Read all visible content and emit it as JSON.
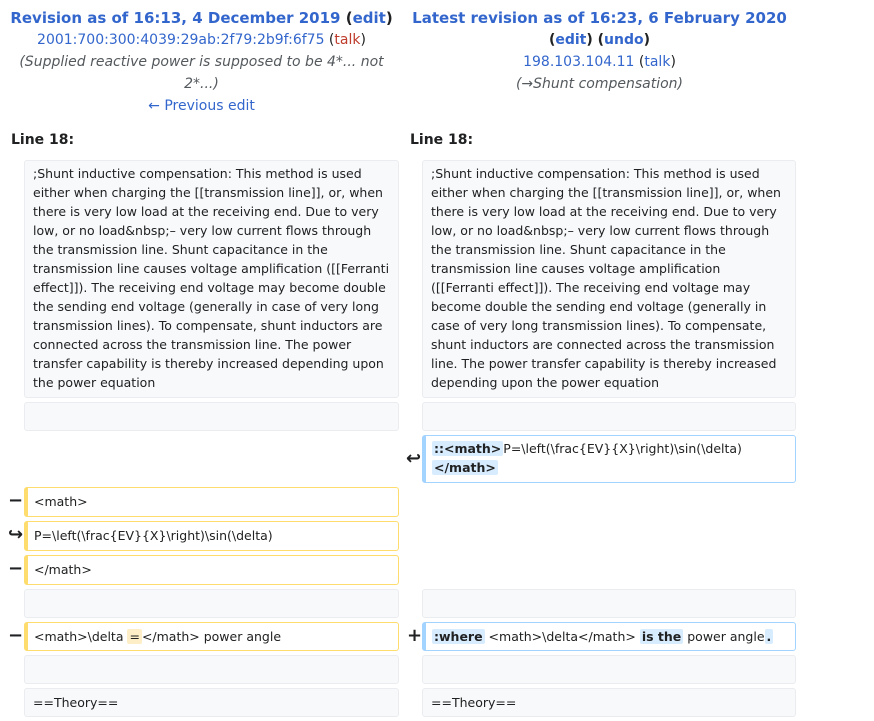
{
  "left_header": {
    "title": "Revision as of 16:13, 4 December 2019",
    "edit_label": "edit",
    "user": "2001:700:300:4039:29ab:2f79:2b9f:6f75",
    "talk_label": "talk",
    "summary": "(Supplied reactive power is supposed to be 4*... not 2*...)",
    "prev_edit": "← Previous edit"
  },
  "right_header": {
    "title": "Latest revision as of 16:23, 6 February 2020",
    "edit_label": "edit",
    "undo_label": "undo",
    "user": "198.103.104.11",
    "talk_label": "talk",
    "summary": "(→Shunt compensation)"
  },
  "line_label": "Line 18:",
  "context_paragraph": ";Shunt inductive compensation: This method is used either when charging the [[transmission line]], or, when there is very low load at the receiving end. Due to very low, or no load&nbsp;– very low current flows through the transmission line. Shunt capacitance in the transmission line causes voltage amplification ([[Ferranti effect]]). The receiving end voltage may become double the sending end voltage (generally in case of very long transmission lines). To compensate, shunt inductors are connected across the transmission line. The power transfer capability is thereby increased depending upon the power equation",
  "diff": {
    "moved_added": {
      "part1": "::<math>",
      "part2": "P=\\left(\\frac{EV}{X}\\right)\\sin(\\delta)",
      "part3": "</math>"
    },
    "removed_1": "<math>",
    "moved_removed": "P=\\left(\\frac{EV}{X}\\right)\\sin(\\delta)",
    "removed_2": "</math>",
    "removed_3": {
      "p1": "<math>\\delta ",
      "p2": "=",
      "p3": "</math> power angle"
    },
    "added_3": {
      "p1": ":where",
      "p2": " <math>\\delta</math> ",
      "p3": "is the",
      "p4": " power angle",
      "p5": "."
    },
    "theory": "==Theory=="
  },
  "markers": {
    "minus": "−",
    "plus": "+",
    "moved_in": "↩",
    "moved_out": "↪"
  }
}
